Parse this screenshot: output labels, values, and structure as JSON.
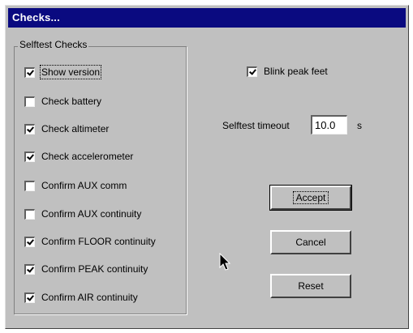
{
  "window": {
    "title": "Checks..."
  },
  "selftest_group": {
    "legend": "Selftest Checks",
    "items": [
      {
        "label": "Show version",
        "checked": true,
        "focused": true
      },
      {
        "label": "Check battery",
        "checked": false
      },
      {
        "label": "Check altimeter",
        "checked": true
      },
      {
        "label": "Check accelerometer",
        "checked": true
      },
      {
        "label": "Confirm AUX comm",
        "checked": false
      },
      {
        "label": "Confirm AUX continuity",
        "checked": false
      },
      {
        "label": "Confirm FLOOR continuity",
        "checked": true
      },
      {
        "label": "Confirm PEAK continuity",
        "checked": true
      },
      {
        "label": "Confirm AIR continuity",
        "checked": true
      }
    ]
  },
  "blink": {
    "label": "Blink peak feet",
    "checked": true
  },
  "timeout": {
    "label": "Selftest timeout",
    "value": "10.0",
    "unit": "s"
  },
  "buttons": {
    "accept": "Accept",
    "cancel": "Cancel",
    "reset": "Reset"
  }
}
